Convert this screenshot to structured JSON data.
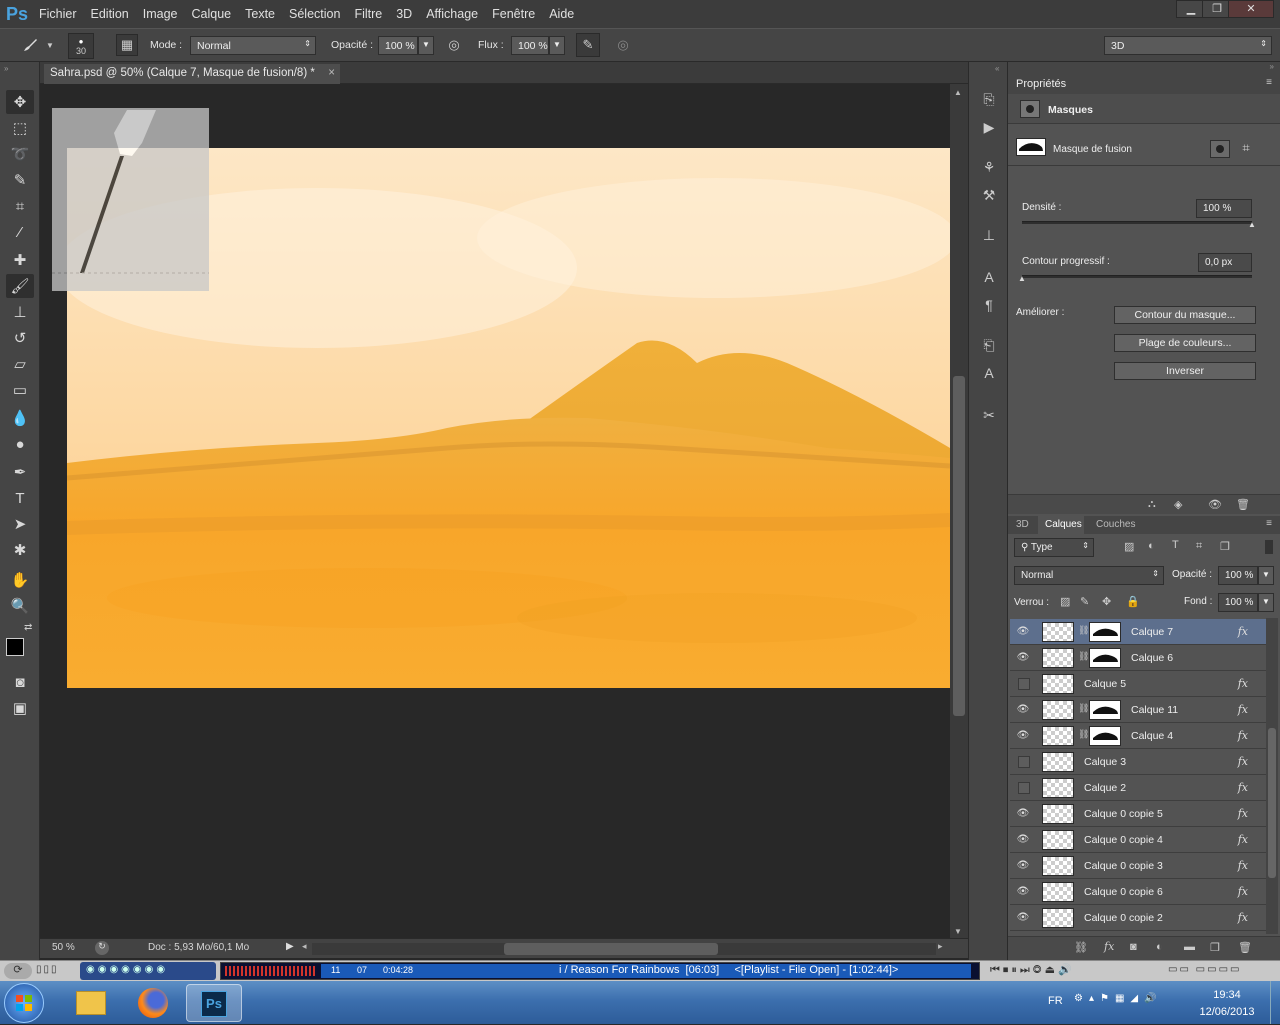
{
  "app": {
    "logo": "Ps"
  },
  "menu": [
    "Fichier",
    "Edition",
    "Image",
    "Calque",
    "Texte",
    "Sélection",
    "Filtre",
    "3D",
    "Affichage",
    "Fenêtre",
    "Aide"
  ],
  "window_controls": {
    "minimize": "▁",
    "restore": "❐",
    "close": "✕"
  },
  "options_bar": {
    "brush_size": "30",
    "mode_label": "Mode :",
    "mode_value": "Normal",
    "opacity_label": "Opacité :",
    "opacity_value": "100 %",
    "flow_label": "Flux :",
    "flow_value": "100 %",
    "workspace": "3D"
  },
  "document": {
    "tab_title": "Sahra.psd @ 50% (Calque 7, Masque de fusion/8) *",
    "tab_close": "×",
    "zoom": "50 %",
    "doc_info": "Doc : 5,93 Mo/60,1 Mo"
  },
  "properties": {
    "panel_title": "Propriétés",
    "section": "Masques",
    "mask_label": "Masque de fusion",
    "density_label": "Densité :",
    "density_value": "100 %",
    "density_level": 1.0,
    "feather_label": "Contour progressif :",
    "feather_value": "0,0 px",
    "feather_level": 0.0,
    "refine_label": "Améliorer :",
    "btn_edge": "Contour du masque...",
    "btn_color_range": "Plage de couleurs...",
    "btn_invert": "Inverser"
  },
  "layers_panel": {
    "tabs": [
      "3D",
      "Calques",
      "Couches"
    ],
    "active_tab": "Calques",
    "filter_kind": "Type",
    "blend_mode": "Normal",
    "opacity_label": "Opacité :",
    "opacity_value": "100 %",
    "lock_label": "Verrou :",
    "fill_label": "Fond :",
    "fill_value": "100 %",
    "fx_label": "fx",
    "layers": [
      {
        "name": "Calque 7",
        "visible": true,
        "mask": true,
        "selected": true
      },
      {
        "name": "Calque 6",
        "visible": true,
        "mask": true,
        "selected": false
      },
      {
        "name": "Calque 5",
        "visible": false,
        "mask": false,
        "selected": false
      },
      {
        "name": "Calque 11",
        "visible": true,
        "mask": true,
        "selected": false
      },
      {
        "name": "Calque 4",
        "visible": true,
        "mask": true,
        "selected": false
      },
      {
        "name": "Calque 3",
        "visible": false,
        "mask": false,
        "selected": false
      },
      {
        "name": "Calque 2",
        "visible": false,
        "mask": false,
        "selected": false
      },
      {
        "name": "Calque 0 copie 5",
        "visible": true,
        "mask": false,
        "selected": false
      },
      {
        "name": "Calque 0 copie 4",
        "visible": true,
        "mask": false,
        "selected": false
      },
      {
        "name": "Calque 0 copie 3",
        "visible": true,
        "mask": false,
        "selected": false
      },
      {
        "name": "Calque 0 copie 6",
        "visible": true,
        "mask": false,
        "selected": false
      },
      {
        "name": "Calque 0 copie 2",
        "visible": true,
        "mask": false,
        "selected": false
      }
    ]
  },
  "media_player": {
    "track_num": "11",
    "track_num2": "07",
    "time": "0:04:28",
    "now_playing": "i / Reason For Rainbows  [06:03]     <[Playlist - File Open] - [1:02:44]>"
  },
  "taskbar": {
    "lang": "FR",
    "time": "19:34",
    "date": "12/06/2013"
  },
  "colors": {
    "accent": "#4aa3df",
    "selected_layer": "#5d6f8d",
    "sand": "#f4a826",
    "sky": "#fde6c1"
  }
}
